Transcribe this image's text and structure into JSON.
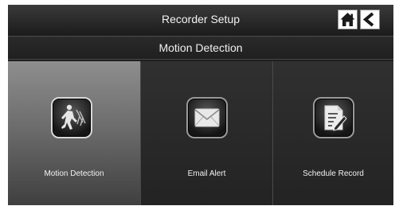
{
  "header": {
    "title": "Recorder Setup",
    "home_icon": "home-icon",
    "back_icon": "back-arrow-icon"
  },
  "subheader": {
    "title": "Motion Detection"
  },
  "menu": {
    "selected_index": 0,
    "items": [
      {
        "label": "Motion Detection",
        "icon": "motion-detection-icon"
      },
      {
        "label": "Email Alert",
        "icon": "envelope-icon"
      },
      {
        "label": "Schedule Record",
        "icon": "schedule-document-icon"
      }
    ]
  },
  "colors": {
    "background": "#1e1e1e",
    "selected_tile": "#6d6d6d",
    "text": "#f2f2f2"
  }
}
